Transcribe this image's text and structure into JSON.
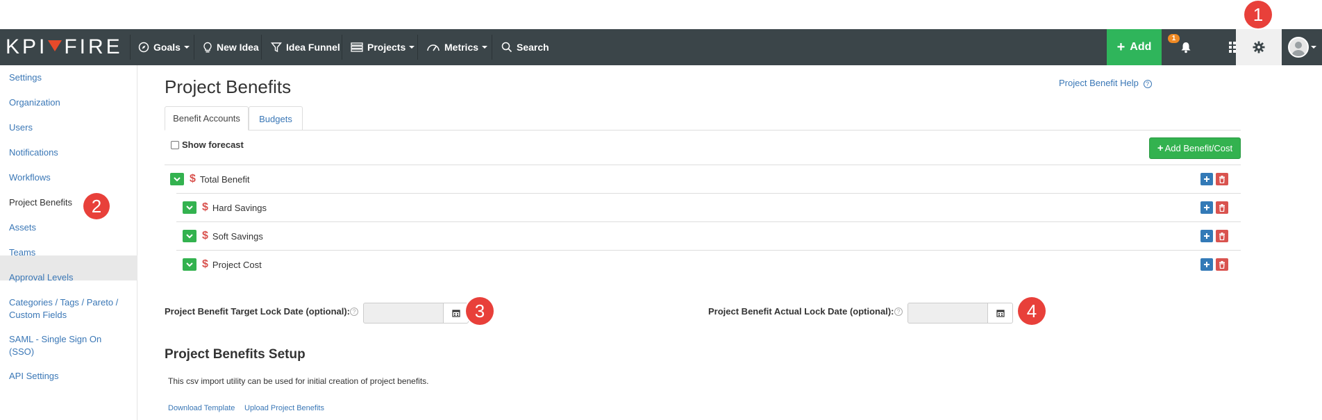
{
  "app": {
    "logo_left": "KPI",
    "logo_right": "FIRE"
  },
  "nav": {
    "goals": "Goals",
    "new_idea": "New Idea",
    "idea_funnel": "Idea Funnel",
    "projects": "Projects",
    "metrics": "Metrics",
    "search": "Search",
    "add": "Add",
    "notification_count": "1"
  },
  "callouts": [
    "1",
    "2",
    "3",
    "4"
  ],
  "sidebar": {
    "items": [
      {
        "label": "Settings"
      },
      {
        "label": "Organization"
      },
      {
        "label": "Users"
      },
      {
        "label": "Notifications"
      },
      {
        "label": "Workflows"
      },
      {
        "label": "Project Benefits"
      },
      {
        "label": "Assets"
      },
      {
        "label": "Teams"
      },
      {
        "label": "Approval Levels"
      },
      {
        "label": "Categories / Tags / Pareto /"
      },
      {
        "label": "Custom Fields"
      },
      {
        "label": "SAML - Single Sign On"
      },
      {
        "label": "(SSO)"
      },
      {
        "label": "API Settings"
      }
    ]
  },
  "main": {
    "title": "Project Benefits",
    "help_link": "Project Benefit Help",
    "tabs": [
      {
        "label": "Benefit Accounts"
      },
      {
        "label": "Budgets"
      }
    ],
    "show_forecast": "Show forecast",
    "add_benefit_cost": "Add Benefit/Cost",
    "tree": [
      {
        "label": "Total Benefit",
        "currency": "$"
      },
      {
        "label": "Hard Savings",
        "currency": "$"
      },
      {
        "label": "Soft Savings",
        "currency": "$"
      },
      {
        "label": "Project Cost",
        "currency": "$"
      }
    ],
    "target_lock_label": "Project Benefit Target Lock Date (optional):",
    "actual_lock_label": "Project Benefit Actual Lock Date (optional):",
    "target_lock_value": "",
    "actual_lock_value": "",
    "setup_title": "Project Benefits Setup",
    "setup_desc": "This csv import utility can be used for initial creation of project benefits.",
    "download_template": "Download Template",
    "upload_benefits": "Upload Project Benefits"
  },
  "colors": {
    "navbar": "#3b4549",
    "accent_green": "#2fb55b",
    "link_blue": "#3a77b6",
    "callout_red": "#e8403a"
  }
}
